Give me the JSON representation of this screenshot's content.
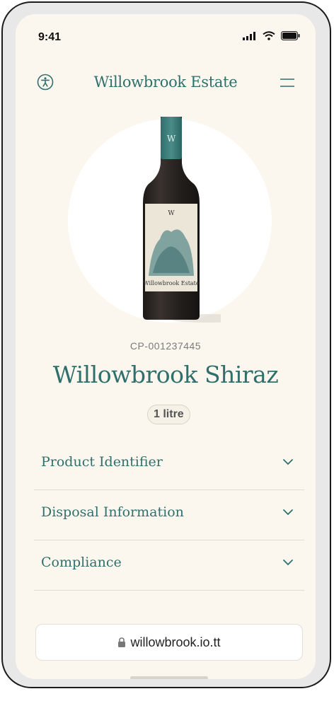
{
  "status_bar": {
    "time": "9:41"
  },
  "header": {
    "brand": "Willowbrook Estate",
    "accessibility_icon": "accessibility-icon",
    "menu_icon": "menu-icon"
  },
  "product": {
    "sku": "CP-001237445",
    "name": "Willowbrook Shiraz",
    "volume": "1 litre",
    "bottle_label_text": "Willowbrook Estate"
  },
  "accordion": [
    {
      "label": "Product Identifier"
    },
    {
      "label": "Disposal Information"
    },
    {
      "label": "Compliance"
    }
  ],
  "url_bar": {
    "url": "willowbrook.io.tt",
    "lock_icon": "lock-icon"
  },
  "colors": {
    "brand": "#2f6f6c",
    "background": "#fcf7ee",
    "bottle": "#2b2623"
  }
}
